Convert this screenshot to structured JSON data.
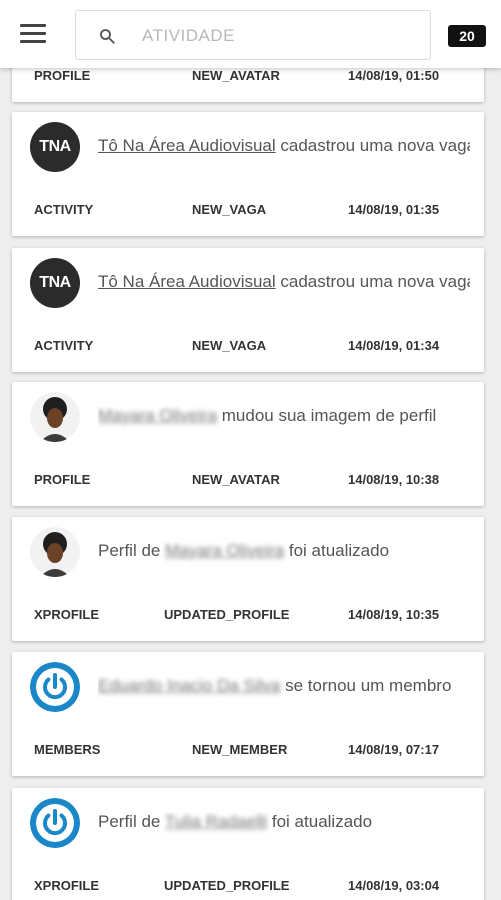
{
  "header": {
    "search_placeholder": "ATIVIDADE",
    "count_badge": "20"
  },
  "activities": [
    {
      "component": "PROFILE",
      "type": "NEW_AVATAR",
      "date": "14/08/19, 01:50"
    },
    {
      "avatar": "TNA",
      "name": "Tô Na Área Audiovisual",
      "text": " cadastrou uma nova vaga",
      "component": "ACTIVITY",
      "type": "NEW_VAGA",
      "date": "14/08/19, 01:35"
    },
    {
      "avatar": "TNA",
      "name": "Tô Na Área Audiovisual",
      "text": " cadastrou uma nova vaga",
      "component": "ACTIVITY",
      "type": "NEW_VAGA",
      "date": "14/08/19, 01:34"
    },
    {
      "name": "Mayara Oliveira",
      "text": " mudou sua imagem de perfil",
      "component": "PROFILE",
      "type": "NEW_AVATAR",
      "date": "14/08/19, 10:38"
    },
    {
      "prefix": "Perfil de ",
      "name": "Mayara Oliveira",
      "text": " foi atualizado",
      "component": "XPROFILE",
      "type": "UPDATED_PROFILE",
      "date": "14/08/19, 10:35"
    },
    {
      "name": "Eduardo Inacio Da Silva",
      "text": " se tornou um membro",
      "component": "MEMBERS",
      "type": "NEW_MEMBER",
      "date": "14/08/19, 07:17"
    },
    {
      "prefix": "Perfil de ",
      "name": "Tulia Radaelli",
      "text": " foi atualizado",
      "component": "XPROFILE",
      "type": "UPDATED_PROFILE",
      "date": "14/08/19, 03:04"
    }
  ]
}
